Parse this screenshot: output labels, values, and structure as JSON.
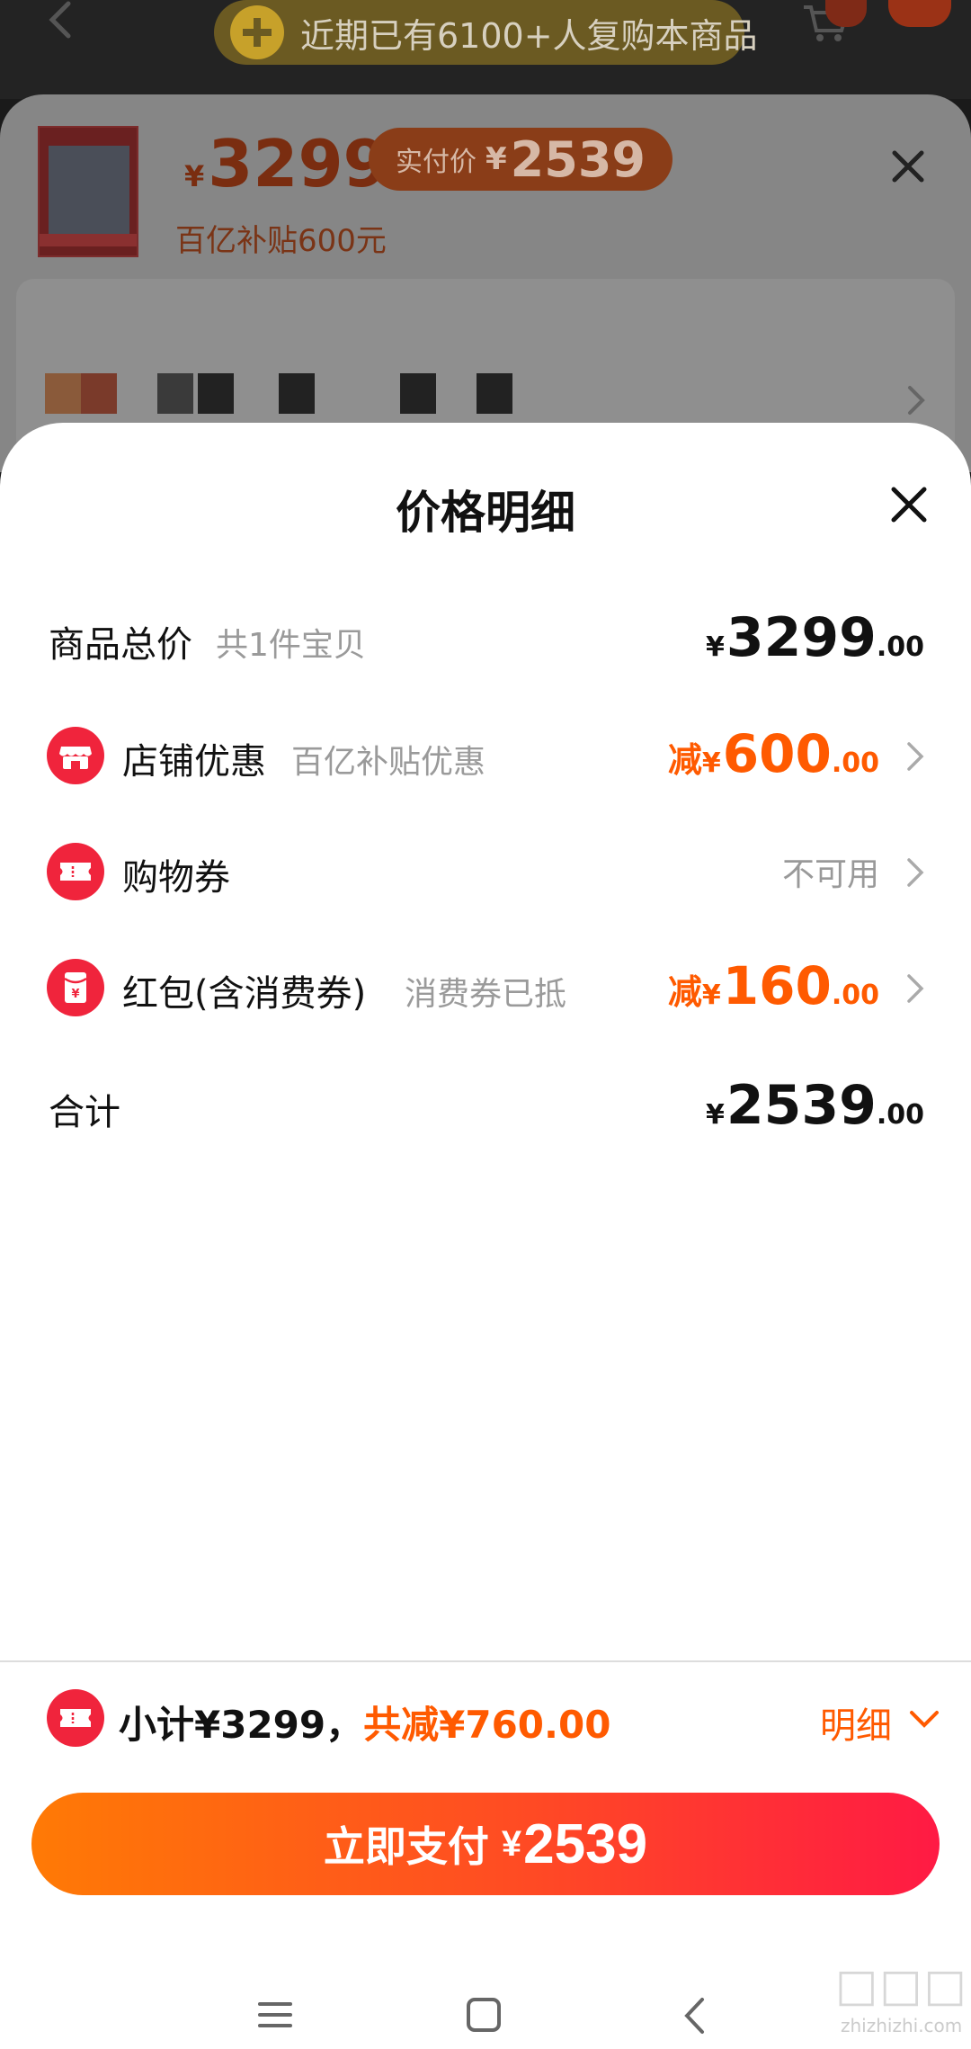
{
  "background": {
    "banner_text": "近期已有6100+人复购本商品",
    "product_price_currency": "¥",
    "product_price": "3299",
    "actual_price_label": "实付价",
    "actual_price_currency": "¥",
    "actual_price": "2539",
    "subsidy_text": "百亿补贴600元"
  },
  "sheet": {
    "title": "价格明细",
    "rows": [
      {
        "label": "商品总价",
        "sub": "共1件宝贝",
        "amount_currency": "¥",
        "amount_int": "3299",
        "amount_dec": ".00",
        "icon": "none"
      },
      {
        "label": "店铺优惠",
        "sub": "百亿补贴优惠",
        "amount_prefix": "减",
        "amount_currency": "¥",
        "amount_int": "600",
        "amount_dec": ".00",
        "icon": "shop-icon"
      },
      {
        "label": "购物券",
        "amount_text": "不可用",
        "icon": "coupon-icon"
      },
      {
        "label": "红包(含消费券)",
        "sub": "消费券已抵",
        "amount_prefix": "减",
        "amount_currency": "¥",
        "amount_int": "160",
        "amount_dec": ".00",
        "icon": "red-envelope-icon"
      },
      {
        "label": "合计",
        "amount_currency": "¥",
        "amount_int": "2539",
        "amount_dec": ".00",
        "icon": "none"
      }
    ]
  },
  "summary": {
    "subtotal_text": "小计¥3299，",
    "discount_text": "共减¥760.00",
    "detail_link": "明细"
  },
  "pay_button": {
    "label": "立即支付",
    "currency": "¥",
    "amount": "2539"
  },
  "watermark": {
    "url": "zhizhizhi.com"
  },
  "colors": {
    "accent": "#ff5a00",
    "pay_gradient_start": "#ff7a05",
    "pay_gradient_end": "#ff1a44",
    "icon_red": "#f0243c"
  }
}
